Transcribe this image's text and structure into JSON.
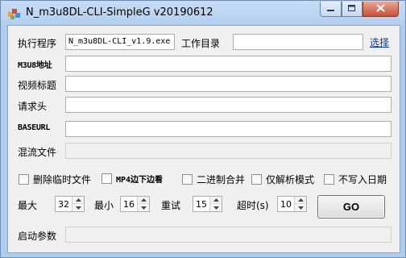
{
  "window": {
    "title": "N_m3u8DL-CLI-SimpleG v20190612"
  },
  "icons": {
    "app": "app-logo-icon",
    "minimize": "minimize-icon",
    "maximize": "maximize-icon",
    "close": "close-icon"
  },
  "form": {
    "exe_label": "执行程序",
    "exe_value": "N_m3u8DL-CLI_v1.9.exe",
    "workdir_label": "工作目录",
    "workdir_value": "",
    "browse_link": "选择",
    "m3u8_label": "M3U8地址",
    "m3u8_value": "",
    "title_label": "视频标题",
    "title_value": "",
    "headers_label": "请求头",
    "headers_value": "",
    "baseurl_label": "BASEURL",
    "baseurl_value": "",
    "mux_label": "混流文件",
    "mux_value": ""
  },
  "options": [
    {
      "label": "删除临时文件",
      "checked": false
    },
    {
      "label": "MP4边下边看",
      "checked": false
    },
    {
      "label": "二进制合并",
      "checked": false
    },
    {
      "label": "仅解析模式",
      "checked": false
    },
    {
      "label": "不写入日期",
      "checked": false
    }
  ],
  "numbers": {
    "max_label": "最大",
    "max_value": "32",
    "min_label": "最小",
    "min_value": "16",
    "retry_label": "重试",
    "retry_value": "15",
    "timeout_label": "超时(s)",
    "timeout_value": "10"
  },
  "go_button": "GO",
  "startup_label": "启动参数",
  "startup_value": "",
  "colors": {
    "frame": "#aecdee",
    "client": "#f0f0f0",
    "link": "#0033cc",
    "close_button": "#c6503a"
  }
}
